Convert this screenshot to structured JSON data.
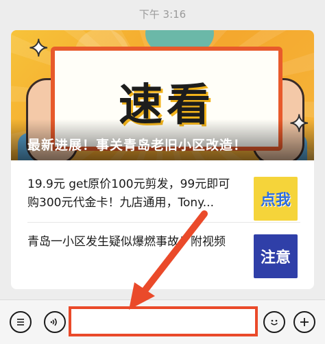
{
  "status": {
    "time": "下午 3:16"
  },
  "article_card": {
    "banner_board_text": "速看",
    "headline": "最新进展！事关青岛老旧小区改造！",
    "items": [
      {
        "text": "19.9元 get原价100元剪发，99元即可购300元代金卡！九店通用，Tony...",
        "thumb_label": "点我"
      },
      {
        "text": "青岛一小区发生疑似爆燃事故！附视频",
        "thumb_label": "注意"
      }
    ]
  },
  "input_bar": {
    "menu_icon": "list-icon",
    "voice_icon": "voice-icon",
    "emoji_icon": "emoji-icon",
    "plus_icon": "plus-icon",
    "input_value": ""
  },
  "annotation": {
    "arrow_color": "#ea4a2a",
    "highlight_color": "#ea4a2a"
  }
}
